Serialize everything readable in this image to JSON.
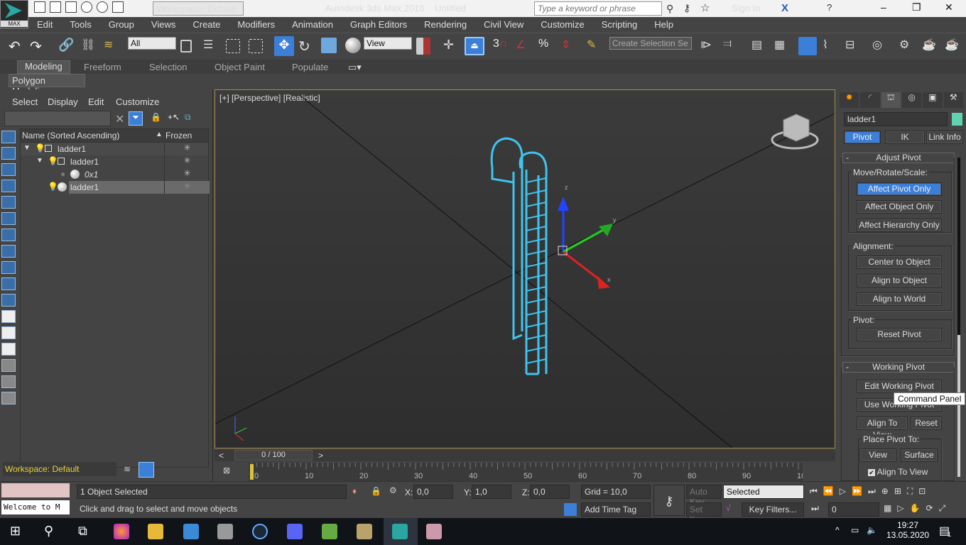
{
  "app": {
    "logo_text": "MAX",
    "workspace": "Workspace: Default",
    "title": "Autodesk 3ds Max 2016",
    "document": "Untitled",
    "search_placeholder": "Type a keyword or phrase",
    "sign_in": "Sign In"
  },
  "menu": [
    "Edit",
    "Tools",
    "Group",
    "Views",
    "Create",
    "Modifiers",
    "Animation",
    "Graph Editors",
    "Rendering",
    "Civil View",
    "Customize",
    "Scripting",
    "Help"
  ],
  "toolbar": {
    "selection_filter": "All",
    "ref_coord": "View",
    "named_selection": "Create Selection Se",
    "snap_label": "3"
  },
  "ribbon": {
    "tabs": [
      "Modeling",
      "Freeform",
      "Selection",
      "Object Paint",
      "Populate"
    ],
    "active": "Modeling",
    "panel": "Polygon Modeling"
  },
  "scene_explorer": {
    "menu": [
      "Select",
      "Display",
      "Edit",
      "Customize"
    ],
    "col_name": "Name (Sorted Ascending)",
    "col_frozen": "Frozen",
    "rows": [
      {
        "name": "ladder1",
        "level": 0
      },
      {
        "name": "ladder1",
        "level": 1
      },
      {
        "name": "0x1",
        "level": 2
      },
      {
        "name": "ladder1",
        "level": 1,
        "selected": true
      }
    ],
    "workspace": "Workspace: Default"
  },
  "viewport": {
    "label": "[+] [Perspective] [Realistic]",
    "gizmo": {
      "x": "x",
      "y": "y",
      "z": "z"
    }
  },
  "command_panel": {
    "object_name": "ladder1",
    "object_color": "#5fd3b0",
    "tabs": [
      "Pivot",
      "IK",
      "Link Info"
    ],
    "active_tab": "Pivot",
    "adjust_pivot": {
      "title": "Adjust Pivot",
      "move_group": "Move/Rotate/Scale:",
      "buttons": [
        "Affect Pivot Only",
        "Affect Object Only",
        "Affect Hierarchy Only"
      ],
      "active": "Affect Pivot Only",
      "alignment": "Alignment:",
      "align_buttons": [
        "Center to Object",
        "Align to Object",
        "Align to World"
      ],
      "pivot": "Pivot:",
      "reset": "Reset Pivot"
    },
    "working_pivot": {
      "title": "Working Pivot",
      "edit": "Edit Working Pivot",
      "use": "Use Working Pivot",
      "align_view": "Align To View",
      "reset": "Reset",
      "place": "Place Pivot To:",
      "view": "View",
      "surface": "Surface",
      "align_check": "Align To View",
      "align_checked": true
    },
    "tooltip": "Command Panel"
  },
  "timeline": {
    "frame": "0 / 100",
    "ticks": [
      "0",
      "10",
      "20",
      "30",
      "40",
      "50",
      "60",
      "70",
      "80",
      "90",
      "100"
    ]
  },
  "status": {
    "listener": "Welcome to M",
    "selected": "1 Object Selected",
    "prompt": "Click and drag to select and move objects",
    "x": "0,0",
    "y": "1,0",
    "z": "0,0",
    "grid": "Grid = 10,0",
    "add_time_tag": "Add Time Tag",
    "auto_key": "Auto Key",
    "set_key": "Set Key",
    "key_mode": "Selected",
    "key_filters": "Key Filters...",
    "frame": "0"
  },
  "taskbar": {
    "time": "19:27",
    "date": "13.05.2020",
    "notifications": "1"
  }
}
